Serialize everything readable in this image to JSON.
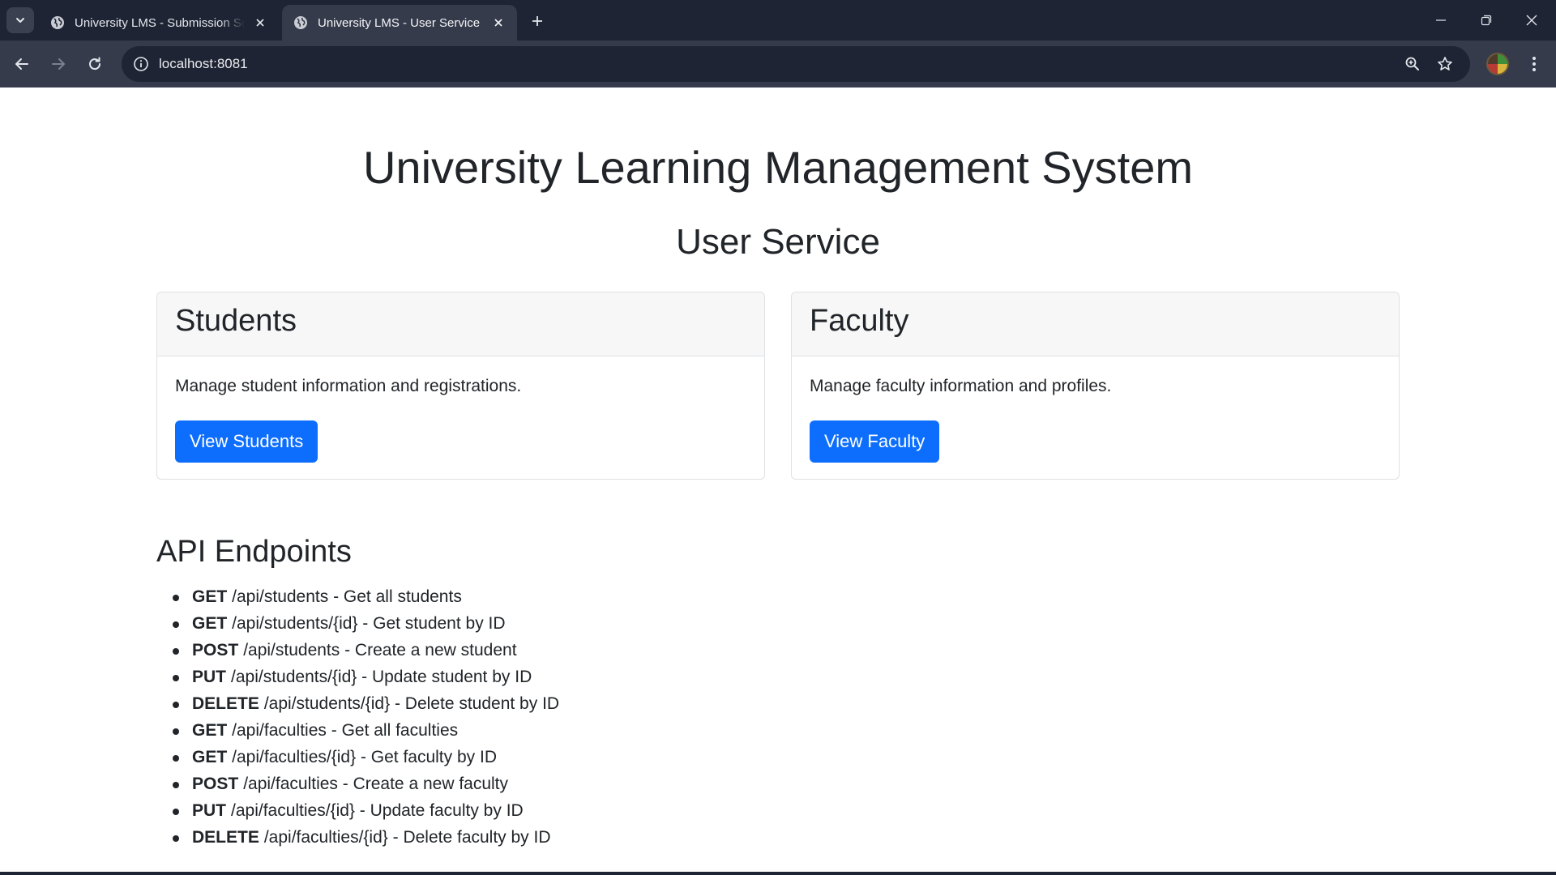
{
  "browser": {
    "tabs": [
      {
        "title": "University LMS - Submission Service",
        "active": false
      },
      {
        "title": "University LMS - User Service",
        "active": true
      }
    ],
    "url": "localhost:8081"
  },
  "page": {
    "title": "University Learning Management System",
    "subtitle": "User Service",
    "cards": [
      {
        "header": "Students",
        "text": "Manage student information and registrations.",
        "button": "View Students"
      },
      {
        "header": "Faculty",
        "text": "Manage faculty information and profiles.",
        "button": "View Faculty"
      }
    ],
    "api_title": "API Endpoints",
    "endpoints": [
      {
        "method": "GET",
        "desc": "/api/students - Get all students"
      },
      {
        "method": "GET",
        "desc": "/api/students/{id} - Get student by ID"
      },
      {
        "method": "POST",
        "desc": "/api/students - Create a new student"
      },
      {
        "method": "PUT",
        "desc": "/api/students/{id} - Update student by ID"
      },
      {
        "method": "DELETE",
        "desc": "/api/students/{id} - Delete student by ID"
      },
      {
        "method": "GET",
        "desc": "/api/faculties - Get all faculties"
      },
      {
        "method": "GET",
        "desc": "/api/faculties/{id} - Get faculty by ID"
      },
      {
        "method": "POST",
        "desc": "/api/faculties - Create a new faculty"
      },
      {
        "method": "PUT",
        "desc": "/api/faculties/{id} - Update faculty by ID"
      },
      {
        "method": "DELETE",
        "desc": "/api/faculties/{id} - Delete faculty by ID"
      }
    ]
  },
  "colors": {
    "primary_button": "#0d6efd",
    "chrome_dark": "#1f2434",
    "chrome_toolbar": "#353b4b"
  }
}
